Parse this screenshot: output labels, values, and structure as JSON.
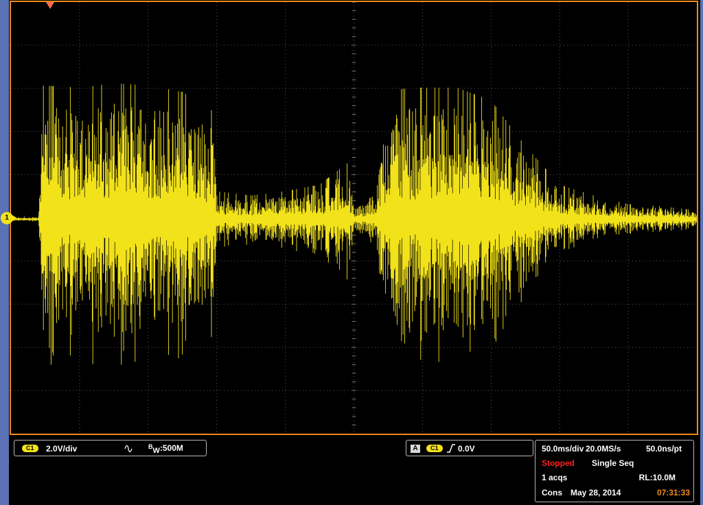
{
  "channel_panel": {
    "channel_badge": "C1",
    "volts_per_div": "2.0V/div",
    "coupling_icon": "ac-sine-icon",
    "bw_prefix": "B",
    "bw_sub": "W",
    "bw_value": ":500M"
  },
  "trigger_panel": {
    "mode_box": "A",
    "source_badge": "C1",
    "slope_icon": "rising-edge-icon",
    "level": "0.0V"
  },
  "status_panel": {
    "timebase": "50.0ms/div",
    "sample_rate": "20.0MS/s",
    "resolution": "50.0ns/pt",
    "state": "Stopped",
    "acq_mode": "Single Seq",
    "acquisitions": "1 acqs",
    "record_length": "RL:10.0M",
    "cons_label": "Cons",
    "date": "May 28, 2014",
    "time": "07:31:33"
  },
  "channel_marker_label": "1",
  "colors": {
    "trace": "#f2e21a",
    "frame": "#f08a1c",
    "stopped": "#ff2020",
    "time": "#f08a1c",
    "side_strip": "#5b72b5"
  },
  "chart_data": {
    "type": "line",
    "title": "",
    "xlabel": "",
    "ylabel": "",
    "x_divisions": 10,
    "y_divisions": 10,
    "time_per_div_ms": 50,
    "volts_per_div": 2.0,
    "ylim_volts": [
      -10,
      10
    ],
    "grid": true,
    "series": [
      {
        "note_unit": "envelope peak amplitude in volts per division segment",
        "x_div": [
          0.0,
          0.4,
          0.45,
          1.0,
          1.5,
          2.0,
          2.5,
          2.95,
          3.0,
          3.5,
          4.0,
          4.5,
          4.9,
          5.0,
          5.3,
          5.5,
          6.0,
          6.5,
          7.0,
          7.5,
          8.0,
          8.5,
          9.0,
          9.5,
          10.0
        ],
        "peak_volts": [
          0.1,
          0.1,
          6.2,
          6.1,
          6.3,
          6.2,
          5.9,
          5.0,
          1.3,
          1.1,
          1.3,
          1.6,
          2.6,
          0.6,
          1.1,
          6.0,
          6.1,
          6.1,
          5.5,
          3.4,
          1.6,
          1.1,
          0.7,
          0.6,
          0.4
        ]
      }
    ]
  }
}
